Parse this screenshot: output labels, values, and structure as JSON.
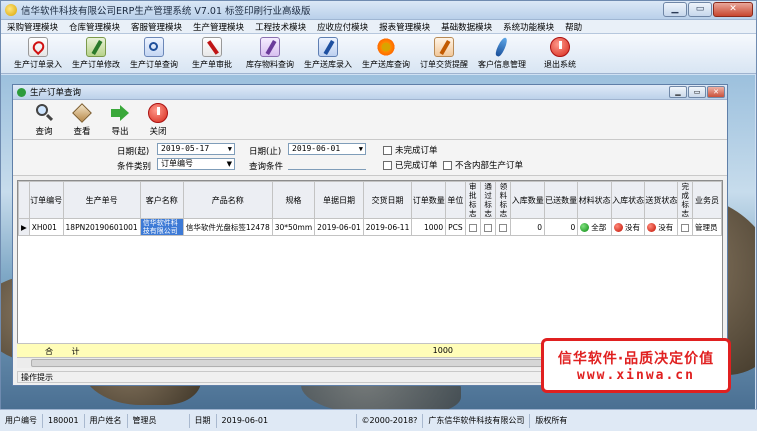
{
  "window": {
    "title": "信华软件科技有限公司ERP生产管理系统  V7.01 标签印刷行业高级版"
  },
  "menu": [
    "采购管理模块",
    "仓库管理模块",
    "客服管理模块",
    "生产管理模块",
    "工程技术模块",
    "应收应付模块",
    "报表管理模块",
    "基础数据模块",
    "系统功能模块",
    "帮助"
  ],
  "toolbar": [
    {
      "label": "生产订单录入",
      "icon": "pdf-document-icon"
    },
    {
      "label": "生产订单修改",
      "icon": "edit-document-icon"
    },
    {
      "label": "生产订单查询",
      "icon": "search-document-icon"
    },
    {
      "label": "生产单审批",
      "icon": "approve-document-icon"
    },
    {
      "label": "库存物料查询",
      "icon": "inventory-icon"
    },
    {
      "label": "生产送库录入",
      "icon": "warehouse-entry-icon"
    },
    {
      "label": "生产送库查询",
      "icon": "flower-icon"
    },
    {
      "label": "订单交货提醒",
      "icon": "reminder-icon"
    },
    {
      "label": "客户信息管理",
      "icon": "customer-icon"
    },
    {
      "label": "退出系统",
      "icon": "power-icon"
    }
  ],
  "child": {
    "title": "生产订单查询",
    "buttons": [
      {
        "label": "查询",
        "icon": "magnifier-icon"
      },
      {
        "label": "查看",
        "icon": "view-icon"
      },
      {
        "label": "导出",
        "icon": "export-arrow-icon"
      },
      {
        "label": "关闭",
        "icon": "close-power-icon"
      }
    ]
  },
  "filter": {
    "date_from_label": "日期(起)",
    "date_from": "2019-05-17",
    "date_to_label": "日期(止)",
    "date_to": "2019-06-01",
    "cond_type_label": "条件类别",
    "cond_type": "订单编号",
    "query_cond_label": "查询条件",
    "query_cond": "",
    "chk_unfinished": "未完成订单",
    "chk_finished": "已完成订单",
    "chk_no_internal": "不含内部生产订单"
  },
  "grid": {
    "headers": [
      "订单编号",
      "生产单号",
      "客户名称",
      "产品名称",
      "规格",
      "单据日期",
      "交货日期",
      "订单数量",
      "单位",
      "审批标志",
      "通过标志",
      "领料标志",
      "入库数量",
      "已送数量",
      "材料状态",
      "入库状态",
      "送货状态",
      "完成标志",
      "业务员"
    ],
    "row": {
      "order_no": "XH001",
      "prod_no": "18PN20190601001",
      "customer": "信华软件科技有限公司",
      "product": "信华软件光盘标签12478",
      "spec": "30*50mm",
      "doc_date": "2019-06-01",
      "delivery_date": "2019-06-11",
      "qty": "1000",
      "unit": "PCS",
      "in_qty": "0",
      "sent_qty": "0",
      "material_status": "全部",
      "in_status": "没有",
      "ship_status": "没有",
      "salesman": "管理员"
    },
    "sum_label": "合 计",
    "sum_qty": "1000"
  },
  "hint": "操作提示",
  "promo": {
    "line1": "信华软件·品质决定价值",
    "line2": "www.xinwa.cn"
  },
  "status": [
    "用户编号",
    "180001",
    "用户姓名",
    "管理员",
    "日期",
    "2019-06-01",
    "©2000-2018?",
    "广东信华软件科技有限公司",
    "版权所有"
  ],
  "colors": {
    "accent": "#3d7ad6",
    "ok": "#0b8a10",
    "bad": "#c10e00",
    "promo": "#e02020"
  }
}
